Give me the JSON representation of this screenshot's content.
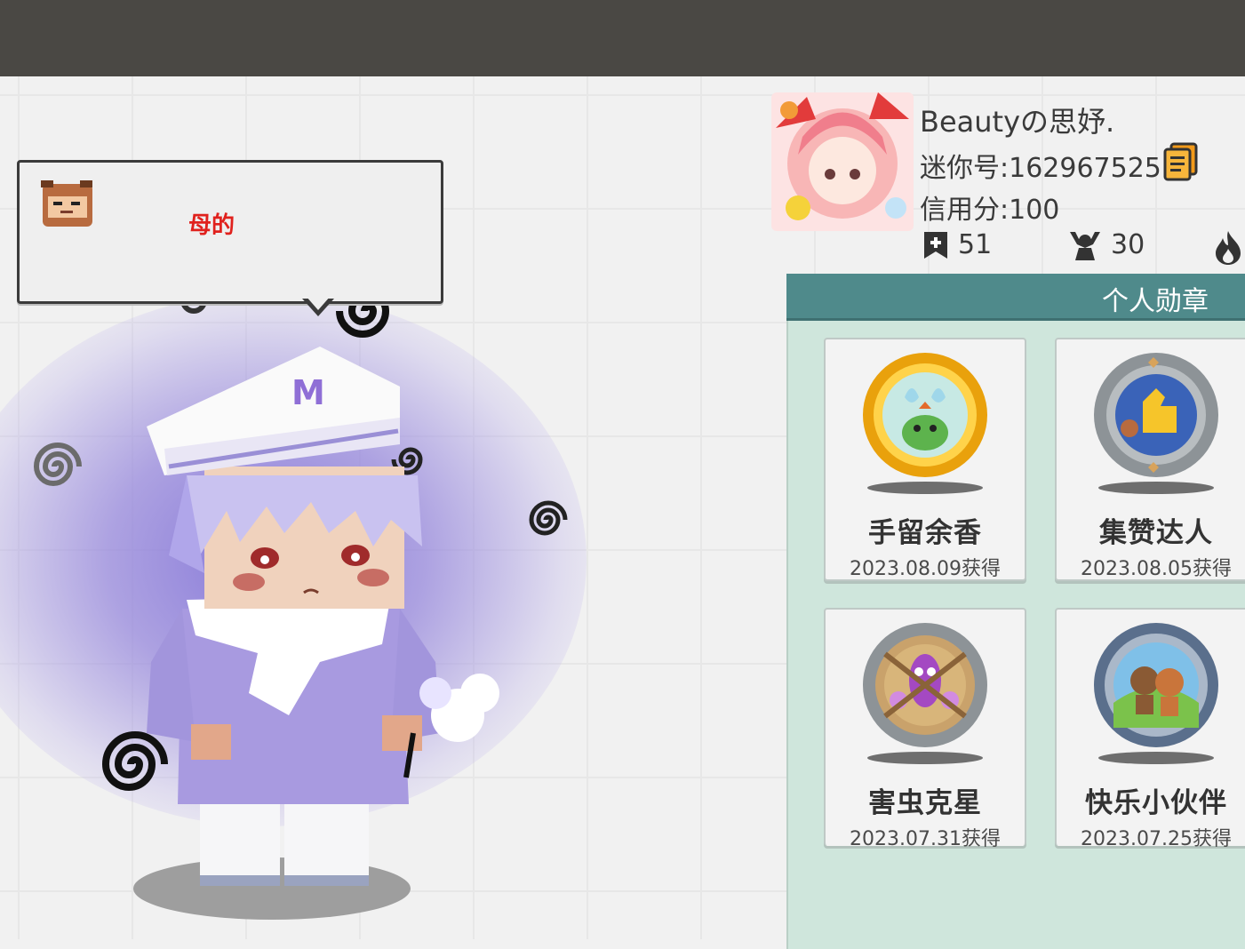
{
  "speech_bubble": {
    "text": "母的"
  },
  "profile": {
    "name": "Beautyの思妤.",
    "mini_id": "迷你号:1629675251",
    "credit": "信用分:100",
    "stats": {
      "add_count": "51",
      "fans_count": "30"
    }
  },
  "medals": {
    "header": "个人勋章",
    "items": [
      {
        "name": "手留余香",
        "date": "2023.08.09获得"
      },
      {
        "name": "集赞达人",
        "date": "2023.08.05获得"
      },
      {
        "name": "害虫克星",
        "date": "2023.07.31获得"
      },
      {
        "name": "快乐小伙伴",
        "date": "2023.07.25获得"
      }
    ]
  },
  "colors": {
    "top_bar": "#4a4844",
    "panel_bg": "#cfe6dc",
    "panel_header": "#4f8a8b",
    "bubble_text": "#e0211d"
  },
  "icons": [
    "copy-icon",
    "add-friend-icon",
    "fans-icon",
    "fire-icon"
  ]
}
